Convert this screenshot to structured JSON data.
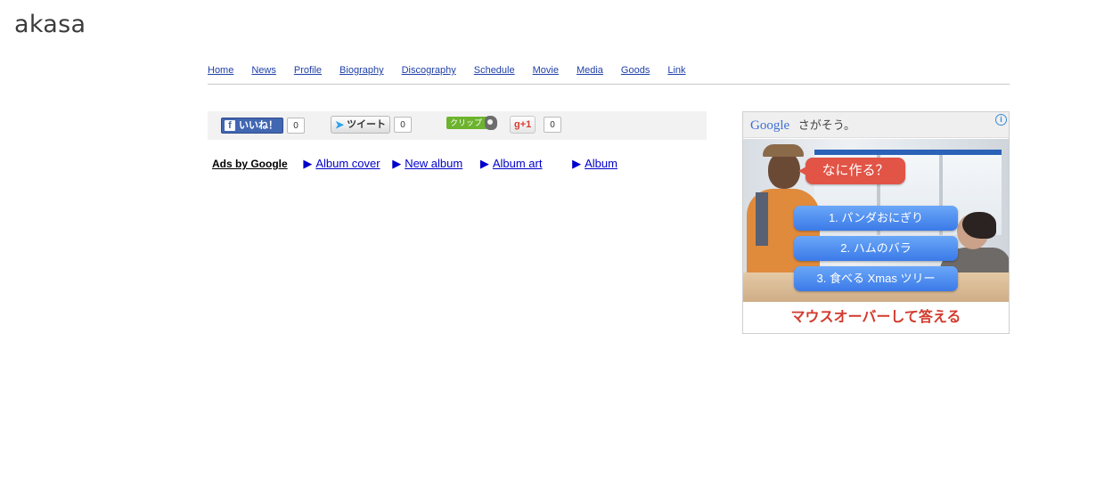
{
  "site": {
    "logo": "akasa"
  },
  "nav": {
    "items": [
      "Home",
      "News",
      "Profile",
      "Biography",
      "Discography",
      "Schedule",
      "Movie",
      "Media",
      "Goods",
      "Link"
    ]
  },
  "social": {
    "facebook_label": "いいね！",
    "facebook_count": "0",
    "tweet_label": "ツイート",
    "tweet_count": "0",
    "clip_label": "クリップ",
    "gplus_label": "+1",
    "gplus_count": "0"
  },
  "ads_links": {
    "title": "Ads by Google",
    "links": [
      "Album cover",
      "New album",
      "Album art",
      "Album"
    ]
  },
  "ad_box": {
    "brand": "Google",
    "tagline": "さがそう。",
    "question": "なに作る？",
    "options": [
      "1. パンダおにぎり",
      "2. ハムのバラ",
      "3. 食べる Xmas ツリー"
    ],
    "footer": "マウスオーバーして答える"
  },
  "colors": {
    "link": "#1f3fa8",
    "facebook": "#4267b2",
    "clip_green": "#6cb32e",
    "ad_red": "#d33a2c",
    "ad_blue": "#3b7ae8"
  }
}
